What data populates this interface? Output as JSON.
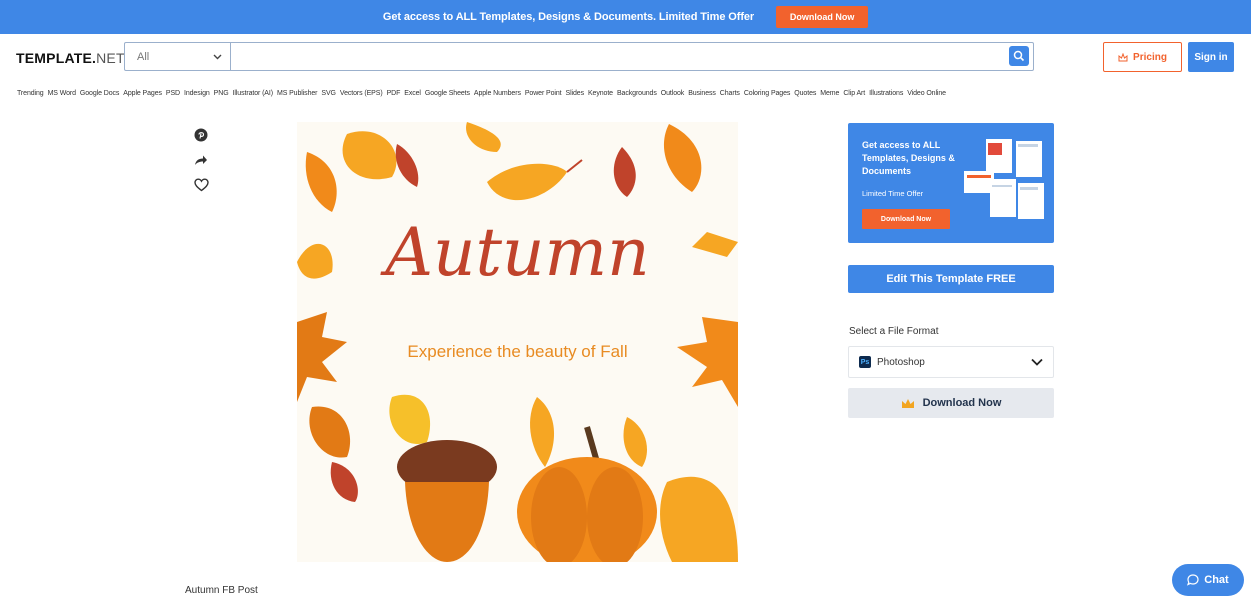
{
  "promo": {
    "text": "Get access to ALL Templates, Designs & Documents. Limited Time Offer",
    "button": "Download Now"
  },
  "header": {
    "logo_bold": "TEMPLATE.",
    "logo_light": "NET",
    "search_category": "All",
    "search_value": "",
    "pricing_label": "Pricing",
    "signin_label": "Sign in"
  },
  "categories": [
    "Trending",
    "MS Word",
    "Google Docs",
    "Apple Pages",
    "PSD",
    "Indesign",
    "PNG",
    "Illustrator (AI)",
    "MS Publisher",
    "SVG",
    "Vectors (EPS)",
    "PDF",
    "Excel",
    "Google Sheets",
    "Apple Numbers",
    "Power Point",
    "Slides",
    "Keynote",
    "Backgrounds",
    "Outlook",
    "Business",
    "Charts",
    "Coloring Pages",
    "Quotes",
    "Meme",
    "Clip Art",
    "Illustrations",
    "Video Online"
  ],
  "share_icons": [
    "pinterest-icon",
    "share-icon",
    "heart-icon"
  ],
  "preview": {
    "title": "Autumn",
    "subtitle": "Experience the beauty of Fall"
  },
  "caption": "Autumn FB Post",
  "ad": {
    "line1": "Get access to ALL",
    "line2": "Templates, Designs &",
    "line3": "Documents",
    "sub": "Limited Time Offer",
    "button": "Download Now"
  },
  "edit_label": "Edit This Template FREE",
  "format": {
    "label": "Select a File Format",
    "selected": "Photoshop",
    "icon_text": "Ps"
  },
  "download_label": "Download Now",
  "chat_label": "Chat",
  "colors": {
    "accent_blue": "#3f87e6",
    "accent_orange": "#f2622d",
    "title_red": "#c0432b",
    "subtitle_orange": "#e88b22"
  }
}
